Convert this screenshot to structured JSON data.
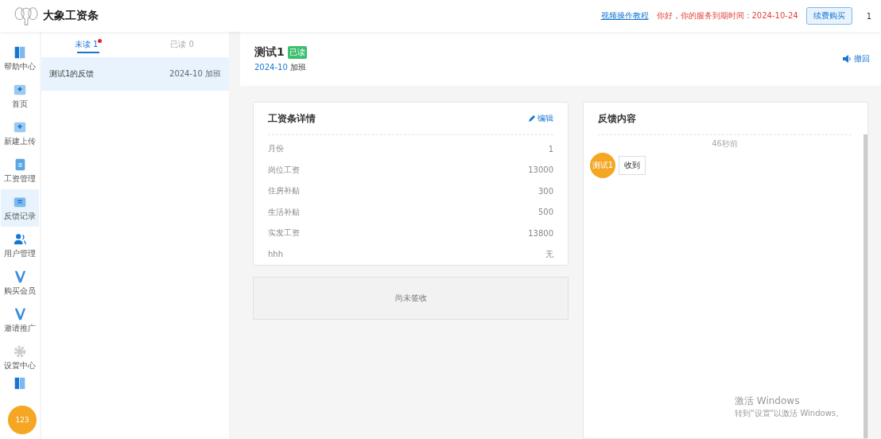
{
  "header": {
    "app_name": "大象工资条",
    "tutorial_link": "视频操作教程",
    "expiry_notice": "你好，你的服务到期时间：2024-10-24",
    "renew_button": "续费购买",
    "user": "1"
  },
  "sidebar": {
    "items": [
      {
        "label": "帮助中心",
        "selected": false
      },
      {
        "label": "首页",
        "selected": false
      },
      {
        "label": "新建上传",
        "selected": false
      },
      {
        "label": "工资管理",
        "selected": false
      },
      {
        "label": "反馈记录",
        "selected": true
      },
      {
        "label": "用户管理",
        "selected": false
      },
      {
        "label": "购买会员",
        "selected": false
      },
      {
        "label": "邀请推广",
        "selected": false
      },
      {
        "label": "设置中心",
        "selected": false
      }
    ],
    "floating_badge": "123"
  },
  "feedback_list": {
    "tabs": [
      {
        "label": "未读 1",
        "selected": true,
        "dot": true
      },
      {
        "label": "已读 0",
        "selected": false,
        "dot": false
      }
    ],
    "items": [
      {
        "title": "测试1的反馈",
        "meta": "2024-10 加班",
        "selected": true
      }
    ]
  },
  "detail": {
    "name": "测试1",
    "status": "已读",
    "period": "2024-10",
    "type": "加班",
    "revoke": "撤回"
  },
  "payslip": {
    "title": "工资条详情",
    "edit": "编辑",
    "rows": [
      {
        "label": "月份",
        "value": "1"
      },
      {
        "label": "岗位工资",
        "value": "13000"
      },
      {
        "label": "住房补贴",
        "value": "300"
      },
      {
        "label": "生活补贴",
        "value": "500"
      },
      {
        "label": "实发工资",
        "value": "13800"
      },
      {
        "label": "hhh",
        "value": "无"
      }
    ],
    "sign_status": "尚未签收"
  },
  "feedback": {
    "title": "反馈内容",
    "time": "46秒前",
    "messages": [
      {
        "sender": "测试1",
        "text": "收到"
      }
    ]
  },
  "os_notice": {
    "title": "激活 Windows",
    "subtitle": "转到\"设置\"以激活 Windows。"
  }
}
